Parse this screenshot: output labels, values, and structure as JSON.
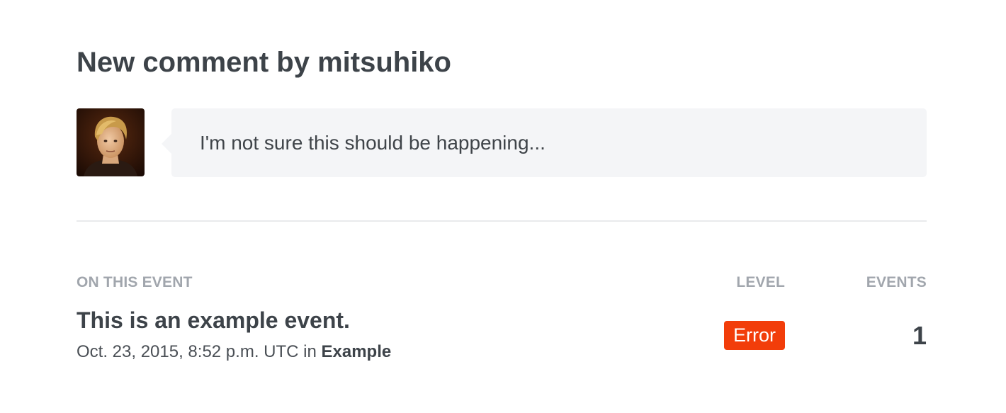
{
  "header": {
    "title": "New comment by mitsuhiko"
  },
  "comment": {
    "author": "mitsuhiko",
    "text": "I'm not sure this should be happening..."
  },
  "event": {
    "section_label": "ON THIS EVENT",
    "level_label": "LEVEL",
    "events_label": "EVENTS",
    "title": "This is an example event.",
    "timestamp": "Oct. 23, 2015, 8:52 p.m. UTC",
    "in_word": "in",
    "project": "Example",
    "level": "Error",
    "count": "1"
  },
  "colors": {
    "error_badge": "#f23d0a",
    "bubble_bg": "#f4f5f7",
    "heading_text": "#3d4349",
    "muted_label": "#a1a6ad"
  }
}
